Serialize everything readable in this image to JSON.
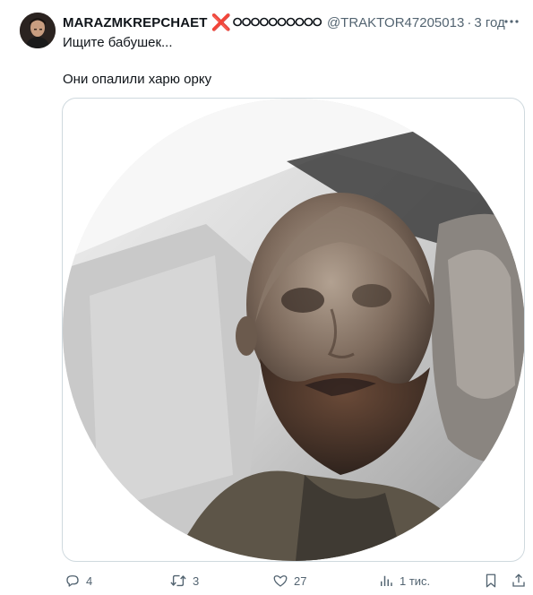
{
  "tweet": {
    "display_name": "MARAZMKREPCHAET",
    "name_cross": "❌",
    "name_zeros": "⭘⭘⭘⭘⭘⭘⭘⭘⭘⭘",
    "handle": "@TRAKTOR47205013",
    "separator": "·",
    "time": "3 год",
    "text_line_1": "Ищите бабушек...",
    "text_line_2": "Они опалили харю орку"
  },
  "actions": {
    "replies": "4",
    "retweets": "3",
    "likes": "27",
    "views": "1 тис."
  },
  "icons": {
    "more": "more-horizontal-icon",
    "reply": "reply-icon",
    "retweet": "retweet-icon",
    "like": "heart-icon",
    "views": "views-chart-icon",
    "bookmark": "bookmark-icon",
    "share": "share-icon"
  },
  "colors": {
    "text_primary": "#0f1419",
    "text_secondary": "#536471",
    "border": "#cfd9de",
    "cross_red": "#e0201a"
  }
}
